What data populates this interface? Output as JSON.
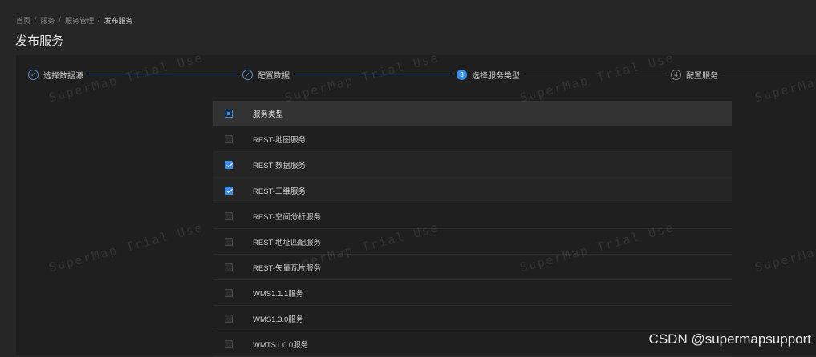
{
  "breadcrumb": {
    "home": "首页",
    "service": "服务",
    "manage": "服务管理",
    "current": "发布服务",
    "sep": "/"
  },
  "page": {
    "title": "发布服务"
  },
  "steps": [
    {
      "label": "选择数据源",
      "state": "done"
    },
    {
      "label": "配置数据",
      "state": "done"
    },
    {
      "label": "选择服务类型",
      "state": "active",
      "num": "3"
    },
    {
      "label": "配置服务",
      "state": "todo",
      "num": "4"
    }
  ],
  "table": {
    "header": "服务类型",
    "rows": [
      {
        "label": "REST-地图服务",
        "checked": false
      },
      {
        "label": "REST-数据服务",
        "checked": true
      },
      {
        "label": "REST-三维服务",
        "checked": true
      },
      {
        "label": "REST-空间分析服务",
        "checked": false
      },
      {
        "label": "REST-地址匹配服务",
        "checked": false
      },
      {
        "label": "REST-矢量瓦片服务",
        "checked": false
      },
      {
        "label": "WMS1.1.1服务",
        "checked": false
      },
      {
        "label": "WMS1.3.0服务",
        "checked": false
      },
      {
        "label": "WMTS1.0.0服务",
        "checked": false
      }
    ]
  },
  "watermark": "SuperMap Trial Use",
  "credit": "CSDN @supermapsupport",
  "colors": {
    "accent": "#3a8ee6",
    "background": "#262626",
    "panel": "#1f1f1f"
  }
}
